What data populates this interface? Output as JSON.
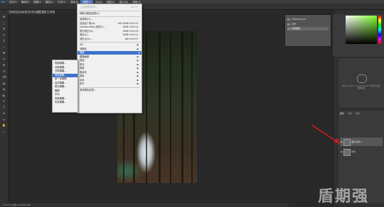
{
  "menubar": {
    "logo": "Ps",
    "items": [
      "文件(F)",
      "编辑(E)",
      "图像(I)",
      "图层(L)",
      "文字(Y)",
      "选择(S)",
      "滤镜(T)",
      "3D(D)",
      "视图(V)",
      "窗口(W)",
      "帮助(H)"
    ],
    "active_index": 6
  },
  "document": {
    "tab_title": "1045141.psd @ 33.3% (图层 副本 1, RGB/8#)",
    "status": "33.33%   文档:15.2M/30.4M"
  },
  "toolbar_icons": [
    "move-icon",
    "marquee-icon",
    "lasso-icon",
    "quick-select-icon",
    "crop-icon",
    "eyedropper-icon",
    "healing-icon",
    "brush-icon",
    "stamp-icon",
    "history-brush-icon",
    "eraser-icon",
    "gradient-icon",
    "blur-tool-icon",
    "dodge-icon",
    "pen-icon",
    "type-icon",
    "path-select-icon",
    "shape-icon",
    "hand-icon",
    "zoom-icon"
  ],
  "filter_menu": {
    "items": [
      {
        "label": "上次滤镜操作(F)",
        "shortcut": "Ctrl+F",
        "disabled": true
      },
      {
        "sep": true
      },
      {
        "label": "转换为智能滤镜(S)",
        "shortcut": ""
      },
      {
        "sep": true
      },
      {
        "label": "滤镜库(G)...",
        "shortcut": ""
      },
      {
        "label": "自适应广角(A)...",
        "shortcut": "Alt+Shift+Ctrl+A"
      },
      {
        "label": "Camera Raw 滤镜(C)...",
        "shortcut": "Shift+Ctrl+A"
      },
      {
        "label": "镜头校正(R)...",
        "shortcut": "Shift+Ctrl+R"
      },
      {
        "label": "液化(L)...",
        "shortcut": "Shift+Ctrl+X"
      },
      {
        "label": "消失点(V)...",
        "shortcut": "Alt+Ctrl+V"
      },
      {
        "sep": true
      },
      {
        "label": "3D",
        "sub": true
      },
      {
        "label": "风格化",
        "sub": true
      },
      {
        "label": "模糊",
        "sub": true,
        "highlight": true
      },
      {
        "label": "模糊画廊",
        "sub": true
      },
      {
        "label": "扭曲",
        "sub": true
      },
      {
        "label": "锐化",
        "sub": true
      },
      {
        "label": "视频",
        "sub": true
      },
      {
        "label": "像素化",
        "sub": true
      },
      {
        "label": "渲染",
        "sub": true
      },
      {
        "label": "杂色",
        "sub": true
      },
      {
        "label": "其它",
        "sub": true
      },
      {
        "sep": true
      },
      {
        "label": "浏览联机滤镜...",
        "shortcut": ""
      }
    ]
  },
  "blur_submenu": {
    "items": [
      {
        "label": "表面模糊..."
      },
      {
        "label": "动感模糊..."
      },
      {
        "label": "方框模糊..."
      },
      {
        "label": "高斯模糊...",
        "highlight": true
      },
      {
        "label": "进一步模糊"
      },
      {
        "label": "径向模糊..."
      },
      {
        "label": "镜头模糊..."
      },
      {
        "label": "模糊"
      },
      {
        "label": "平均"
      },
      {
        "label": "特殊模糊..."
      },
      {
        "label": "形状模糊..."
      }
    ]
  },
  "history_panel": {
    "rows": [
      "1045141.psd",
      "打开",
      "复制图层"
    ]
  },
  "libraries": {
    "text": "使用 Creative Cloud Libraries 同步您的资源",
    "link": "更多信息"
  },
  "layers_panel": {
    "tabs": [
      "图层",
      "通道",
      "路径"
    ],
    "layers": [
      {
        "name": "图层 副本 1",
        "selected": true
      },
      {
        "name": "背景",
        "selected": false
      }
    ]
  },
  "colors": {
    "accent": "#3d73c9",
    "annotation_arrow": "#d21e1e"
  },
  "watermark": "盾期强"
}
